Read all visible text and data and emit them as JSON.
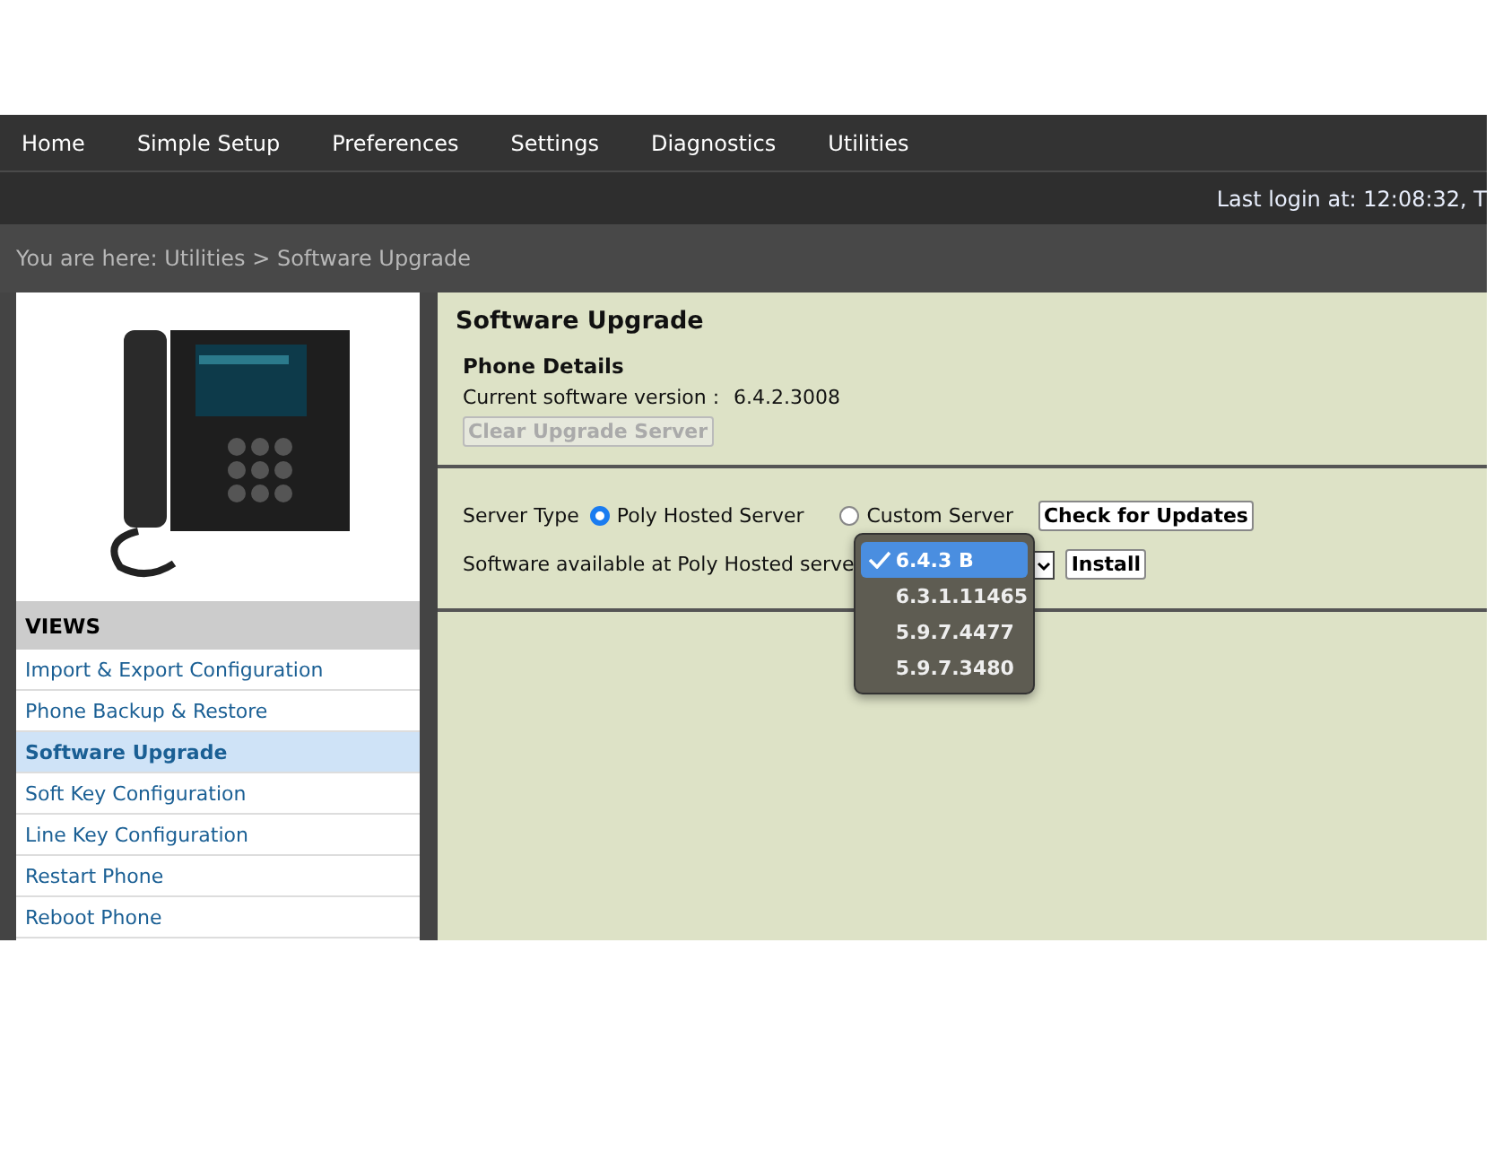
{
  "nav": {
    "items": [
      "Home",
      "Simple Setup",
      "Preferences",
      "Settings",
      "Diagnostics",
      "Utilities"
    ],
    "last_login": "Last login at: 12:08:32, T"
  },
  "breadcrumb": "You are here: Utilities > Software Upgrade",
  "sidebar": {
    "heading": "VIEWS",
    "items": [
      {
        "label": "Import & Export Configuration",
        "selected": false
      },
      {
        "label": "Phone Backup & Restore",
        "selected": false
      },
      {
        "label": "Software Upgrade",
        "selected": true
      },
      {
        "label": "Soft Key Configuration",
        "selected": false
      },
      {
        "label": "Line Key Configuration",
        "selected": false
      },
      {
        "label": "Restart Phone",
        "selected": false
      },
      {
        "label": "Reboot Phone",
        "selected": false
      }
    ]
  },
  "panel": {
    "title": "Software Upgrade",
    "details_heading": "Phone Details",
    "version_label": "Current software version :",
    "version_value": "6.4.2.3008",
    "clear_button": {
      "label": "Clear Upgrade Server",
      "disabled": true
    },
    "server_type_label": "Server Type",
    "server_options": [
      {
        "label": "Poly Hosted Server",
        "selected": true
      },
      {
        "label": "Custom Server",
        "selected": false
      }
    ],
    "check_button": "Check for Updates",
    "available_label": "Software available at Poly Hosted serve",
    "install_button": "Install",
    "versions": [
      {
        "label": "6.4.3 B",
        "selected": true
      },
      {
        "label": "6.3.1.11465",
        "selected": false
      },
      {
        "label": "5.9.7.4477",
        "selected": false
      },
      {
        "label": "5.9.7.3480",
        "selected": false
      }
    ]
  }
}
